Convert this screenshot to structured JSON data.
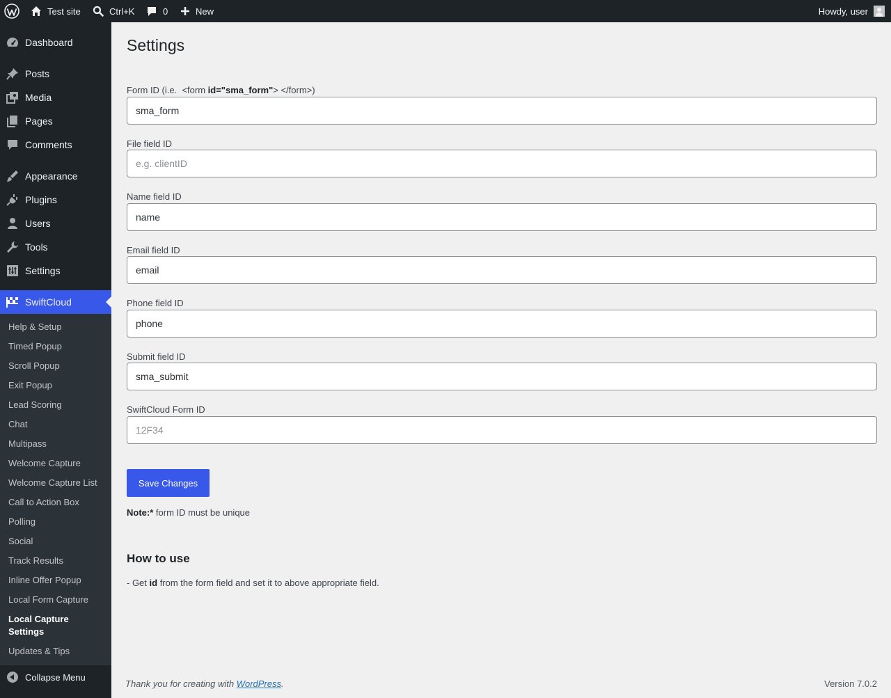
{
  "adminbar": {
    "site_name": "Test site",
    "search_shortcut": "Ctrl+K",
    "comments_count": "0",
    "new_label": "New",
    "howdy": "Howdy, user"
  },
  "sidebar": {
    "items": [
      {
        "label": "Dashboard",
        "icon": "dashboard-icon"
      },
      {
        "label": "Posts",
        "icon": "pin-icon"
      },
      {
        "label": "Media",
        "icon": "media-icon"
      },
      {
        "label": "Pages",
        "icon": "pages-icon"
      },
      {
        "label": "Comments",
        "icon": "comment-icon"
      },
      {
        "label": "Appearance",
        "icon": "brush-icon"
      },
      {
        "label": "Plugins",
        "icon": "plug-icon"
      },
      {
        "label": "Users",
        "icon": "user-icon"
      },
      {
        "label": "Tools",
        "icon": "wrench-icon"
      },
      {
        "label": "Settings",
        "icon": "sliders-icon"
      },
      {
        "label": "SwiftCloud",
        "icon": "checkered-flag-icon"
      }
    ],
    "submenu": [
      "Help & Setup",
      "Timed Popup",
      "Scroll Popup",
      "Exit Popup",
      "Lead Scoring",
      "Chat",
      "Multipass",
      "Welcome Capture",
      "Welcome Capture List",
      "Call to Action Box",
      "Polling",
      "Social",
      "Track Results",
      "Inline Offer Popup",
      "Local Form Capture",
      "Local Capture Settings",
      "Updates & Tips"
    ],
    "collapse_label": "Collapse Menu"
  },
  "main": {
    "title": "Settings",
    "form_id_label_prefix": "Form ID (i.e.  <form ",
    "form_id_label_bold": "id=\"sma_form\"",
    "form_id_label_suffix": "> </form>)",
    "fields": [
      {
        "label": "Form ID",
        "value": "sma_form",
        "placeholder": ""
      },
      {
        "label": "File field ID",
        "value": "",
        "placeholder": "e.g. clientID"
      },
      {
        "label": "Name field ID",
        "value": "name",
        "placeholder": ""
      },
      {
        "label": "Email field ID",
        "value": "email",
        "placeholder": ""
      },
      {
        "label": "Phone field ID",
        "value": "phone",
        "placeholder": ""
      },
      {
        "label": "Submit field ID",
        "value": "sma_submit",
        "placeholder": ""
      },
      {
        "label": "SwiftCloud Form ID",
        "value": "",
        "placeholder": "12F34"
      }
    ],
    "save_label": "Save Changes",
    "note_bold": "Note:*",
    "note_text": " form ID must be unique",
    "howto_title": "How to use",
    "howto_prefix": "- Get ",
    "howto_bold": "id",
    "howto_suffix": " from the form field and set it to above appropriate field."
  },
  "footer": {
    "thanks_prefix": "Thank you for creating with ",
    "wp_link": "WordPress",
    "thanks_suffix": ".",
    "version": "Version 7.0.2"
  },
  "colors": {
    "adminbar_bg": "#1d2327",
    "accent": "#3858e9",
    "page_bg": "#f0f0f1"
  }
}
